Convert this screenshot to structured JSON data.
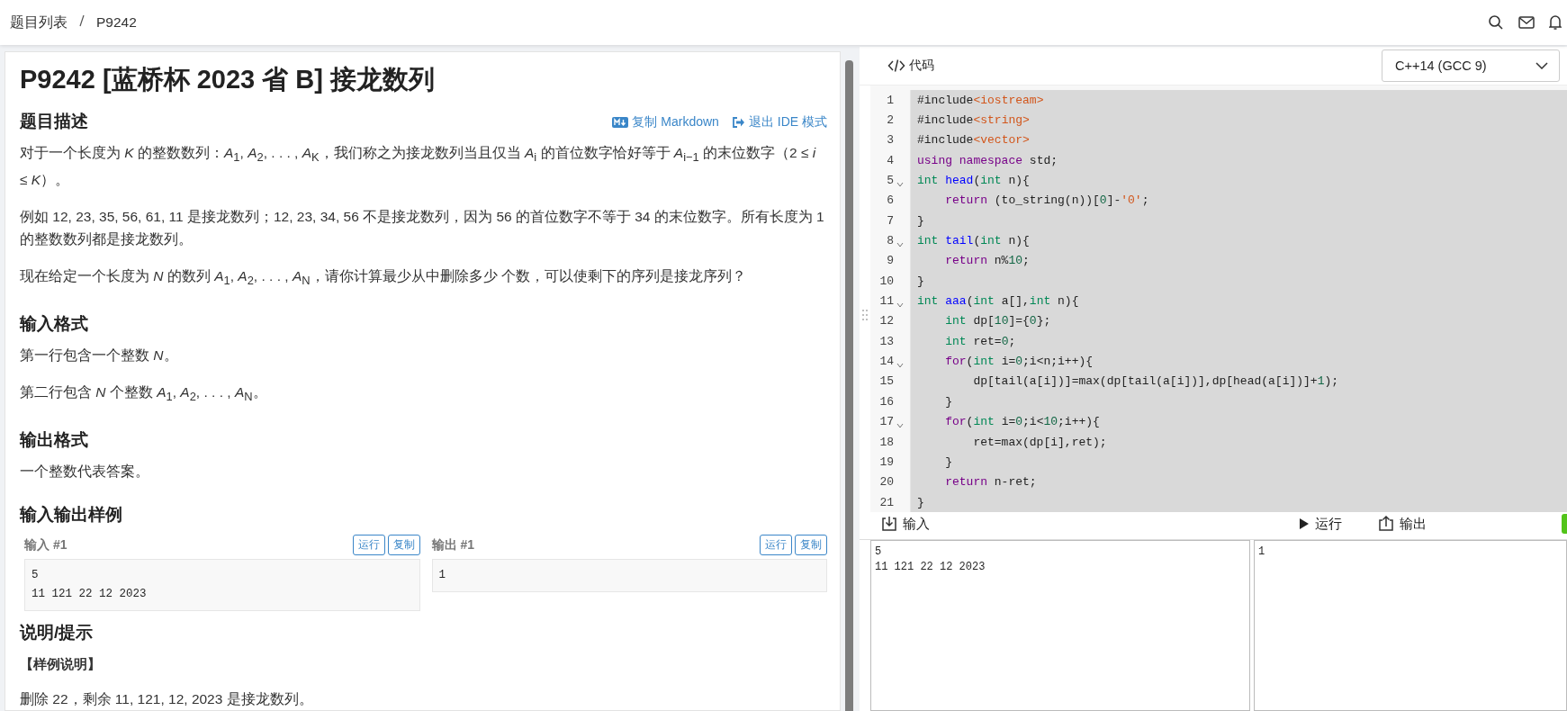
{
  "breadcrumb": [
    "题目列表",
    "P9242"
  ],
  "problem": {
    "title": "P9242 [蓝桥杯 2023 省 B] 接龙数列",
    "actions": [
      {
        "kind": "markdown",
        "label": "复制 Markdown"
      },
      {
        "kind": "exit",
        "label": "退出 IDE 模式"
      }
    ],
    "sections": [
      {
        "heading": "题目描述",
        "blocks": [
          {
            "kind": "p",
            "text": "对于一个长度为 *K* 的整数数列：*A*$_{1}$, *A*$_{2}$, . . . , *A*$_{K}$，我们称之为接龙数列当且仅当 *A*$_{i}$ 的首位数字恰好等于 *A*$_{i−1}$ 的末位数字（2 ≤ *i* ≤ *K*）。"
          },
          {
            "kind": "p",
            "text": "例如 12, 23, 35, 56, 61, 11 是接龙数列；12, 23, 34, 56 不是接龙数列，因为 56 的首位数字不等于 34 的末位数字。所有长度为 1 的整数数列都是接龙数列。"
          },
          {
            "kind": "p",
            "text": "现在给定一个长度为 *N* 的数列 *A*$_{1}$, *A*$_{2}$, . . . , *A*$_{N}$，请你计算最少从中删除多少 个数，可以使剩下的序列是接龙序列？"
          }
        ]
      },
      {
        "heading": "输入格式",
        "blocks": [
          {
            "kind": "p",
            "text": "第一行包含一个整数 *N*。"
          },
          {
            "kind": "p",
            "text": "第二行包含 *N* 个整数 *A*$_{1}$, *A*$_{2}$, . . . , *A*$_{N}$。"
          }
        ]
      },
      {
        "heading": "输出格式",
        "blocks": [
          {
            "kind": "p",
            "text": "一个整数代表答案。"
          }
        ]
      },
      {
        "heading": "输入输出样例",
        "blocks": [
          {
            "kind": "samples",
            "items": [
              {
                "label": "输入 #1",
                "buttons": [
                  "运行",
                  "复制"
                ],
                "content": "5\n11 121 22 12 2023"
              },
              {
                "label": "输出 #1",
                "buttons": [
                  "运行",
                  "复制"
                ],
                "content": "1"
              }
            ]
          }
        ]
      },
      {
        "heading": "说明/提示",
        "blocks": [
          {
            "kind": "bold",
            "text": "【样例说明】"
          },
          {
            "kind": "p",
            "text": "删除 22，剩余 11, 121, 12, 2023 是接龙数列。"
          }
        ]
      }
    ]
  },
  "editor": {
    "label": "代码",
    "language": "C++14 (GCC 9)",
    "selected": true,
    "lines": [
      {
        "n": "1",
        "fold": false,
        "tokens": [
          {
            "t": "#include",
            "kind": "plain"
          },
          {
            "t": "<iostream>",
            "kind": "string"
          }
        ]
      },
      {
        "n": "2",
        "fold": false,
        "tokens": [
          {
            "t": "#include",
            "kind": "plain"
          },
          {
            "t": "<string>",
            "kind": "string"
          }
        ]
      },
      {
        "n": "3",
        "fold": false,
        "tokens": [
          {
            "t": "#include",
            "kind": "plain"
          },
          {
            "t": "<vector>",
            "kind": "string"
          }
        ]
      },
      {
        "n": "4",
        "fold": false,
        "tokens": [
          {
            "t": "using namespace",
            "kind": "keyword"
          },
          {
            "t": " std;",
            "kind": "plain"
          }
        ]
      },
      {
        "n": "5",
        "fold": true,
        "tokens": [
          {
            "t": "int",
            "kind": "type"
          },
          {
            "t": " head",
            "kind": "def"
          },
          {
            "t": "(",
            "kind": "plain"
          },
          {
            "t": "int",
            "kind": "type"
          },
          {
            "t": " n){",
            "kind": "plain"
          }
        ]
      },
      {
        "n": "6",
        "fold": false,
        "tokens": [
          {
            "t": "    return",
            "kind": "keyword"
          },
          {
            "t": " (to_string(n))[",
            "kind": "plain"
          },
          {
            "t": "0",
            "kind": "number"
          },
          {
            "t": "]-",
            "kind": "plain"
          },
          {
            "t": "'0'",
            "kind": "string"
          },
          {
            "t": ";",
            "kind": "plain"
          }
        ]
      },
      {
        "n": "7",
        "fold": false,
        "tokens": [
          {
            "t": "}",
            "kind": "plain"
          }
        ]
      },
      {
        "n": "8",
        "fold": true,
        "tokens": [
          {
            "t": "int",
            "kind": "type"
          },
          {
            "t": " tail",
            "kind": "def"
          },
          {
            "t": "(",
            "kind": "plain"
          },
          {
            "t": "int",
            "kind": "type"
          },
          {
            "t": " n){",
            "kind": "plain"
          }
        ]
      },
      {
        "n": "9",
        "fold": false,
        "tokens": [
          {
            "t": "    return",
            "kind": "keyword"
          },
          {
            "t": " n%",
            "kind": "plain"
          },
          {
            "t": "10",
            "kind": "number"
          },
          {
            "t": ";",
            "kind": "plain"
          }
        ]
      },
      {
        "n": "10",
        "fold": false,
        "tokens": [
          {
            "t": "}",
            "kind": "plain"
          }
        ]
      },
      {
        "n": "11",
        "fold": true,
        "tokens": [
          {
            "t": "int",
            "kind": "type"
          },
          {
            "t": " aaa",
            "kind": "def"
          },
          {
            "t": "(",
            "kind": "plain"
          },
          {
            "t": "int",
            "kind": "type"
          },
          {
            "t": " a[],",
            "kind": "plain"
          },
          {
            "t": "int",
            "kind": "type"
          },
          {
            "t": " n){",
            "kind": "plain"
          }
        ]
      },
      {
        "n": "12",
        "fold": false,
        "tokens": [
          {
            "t": "    int",
            "kind": "type"
          },
          {
            "t": " dp[",
            "kind": "plain"
          },
          {
            "t": "10",
            "kind": "number"
          },
          {
            "t": "]={",
            "kind": "plain"
          },
          {
            "t": "0",
            "kind": "number"
          },
          {
            "t": "};",
            "kind": "plain"
          }
        ]
      },
      {
        "n": "13",
        "fold": false,
        "tokens": [
          {
            "t": "    int",
            "kind": "type"
          },
          {
            "t": " ret=",
            "kind": "plain"
          },
          {
            "t": "0",
            "kind": "number"
          },
          {
            "t": ";",
            "kind": "plain"
          }
        ]
      },
      {
        "n": "14",
        "fold": true,
        "tokens": [
          {
            "t": "    for",
            "kind": "keyword"
          },
          {
            "t": "(",
            "kind": "plain"
          },
          {
            "t": "int",
            "kind": "type"
          },
          {
            "t": " i=",
            "kind": "plain"
          },
          {
            "t": "0",
            "kind": "number"
          },
          {
            "t": ";i<n;i++){",
            "kind": "plain"
          }
        ]
      },
      {
        "n": "15",
        "fold": false,
        "tokens": [
          {
            "t": "        dp[tail(a[i])]=max(dp[tail(a[i])],dp[head(a[i])]+",
            "kind": "plain"
          },
          {
            "t": "1",
            "kind": "number"
          },
          {
            "t": ");",
            "kind": "plain"
          }
        ]
      },
      {
        "n": "16",
        "fold": false,
        "tokens": [
          {
            "t": "    }",
            "kind": "plain"
          }
        ]
      },
      {
        "n": "17",
        "fold": true,
        "tokens": [
          {
            "t": "    for",
            "kind": "keyword"
          },
          {
            "t": "(",
            "kind": "plain"
          },
          {
            "t": "int",
            "kind": "type"
          },
          {
            "t": " i=",
            "kind": "plain"
          },
          {
            "t": "0",
            "kind": "number"
          },
          {
            "t": ";i<",
            "kind": "plain"
          },
          {
            "t": "10",
            "kind": "number"
          },
          {
            "t": ";i++){",
            "kind": "plain"
          }
        ]
      },
      {
        "n": "18",
        "fold": false,
        "tokens": [
          {
            "t": "        ret=max(dp[i],ret);",
            "kind": "plain"
          }
        ]
      },
      {
        "n": "19",
        "fold": false,
        "tokens": [
          {
            "t": "    }",
            "kind": "plain"
          }
        ]
      },
      {
        "n": "20",
        "fold": false,
        "tokens": [
          {
            "t": "    return",
            "kind": "keyword"
          },
          {
            "t": " n-ret;",
            "kind": "plain"
          }
        ]
      },
      {
        "n": "21",
        "fold": false,
        "tokens": [
          {
            "t": "}",
            "kind": "plain"
          }
        ]
      }
    ]
  },
  "io": {
    "input_label": "输入",
    "run_label": "运行",
    "output_label": "输出",
    "input": "5\n11 121 22 12 2023",
    "output": "1"
  }
}
